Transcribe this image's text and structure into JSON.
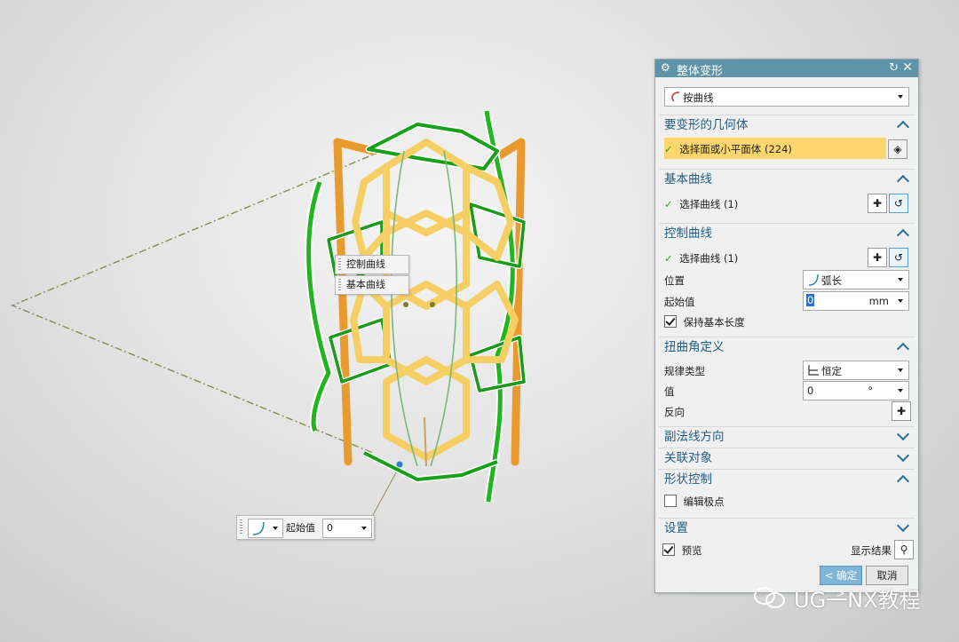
{
  "viewport": {
    "tag_control_curve": "控制曲线",
    "tag_base_curve": "基本曲线",
    "minibar": {
      "label": "起始值",
      "value": "0"
    }
  },
  "dialog": {
    "title": "整体变形",
    "method": "按曲线",
    "sections": {
      "geometry": {
        "title": "要变形的几何体",
        "select_label": "选择面或小平面体 (224)"
      },
      "base_curve": {
        "title": "基本曲线",
        "select_label": "选择曲线 (1)"
      },
      "control_curve": {
        "title": "控制曲线",
        "select_label": "选择曲线 (1)",
        "position_label": "位置",
        "position_value": "弧长",
        "start_label": "起始值",
        "start_value": "0",
        "start_unit": "mm",
        "keep_length_label": "保持基本长度"
      },
      "twist": {
        "title": "扭曲角定义",
        "law_label": "规律类型",
        "law_value": "恒定",
        "value_label": "值",
        "value_value": "0",
        "value_unit": "°",
        "reverse_label": "反向"
      },
      "binormal": {
        "title": "副法线方向"
      },
      "associated": {
        "title": "关联对象"
      },
      "shape": {
        "title": "形状控制",
        "edit_poles_label": "编辑极点"
      },
      "settings": {
        "title": "设置"
      }
    },
    "preview_label": "预览",
    "show_result_label": "显示结果",
    "ok_label": "< 确定 >",
    "cancel_label": "取消"
  },
  "watermark": "UG一NX教程",
  "colors": {
    "titlebar": "#5f93a7",
    "section_title": "#1f5e84",
    "selection_highlight": "#ffd66b",
    "mesh_green": "#22b522",
    "part_orange": "#f2a43c",
    "part_yellow": "#f7d77a"
  }
}
